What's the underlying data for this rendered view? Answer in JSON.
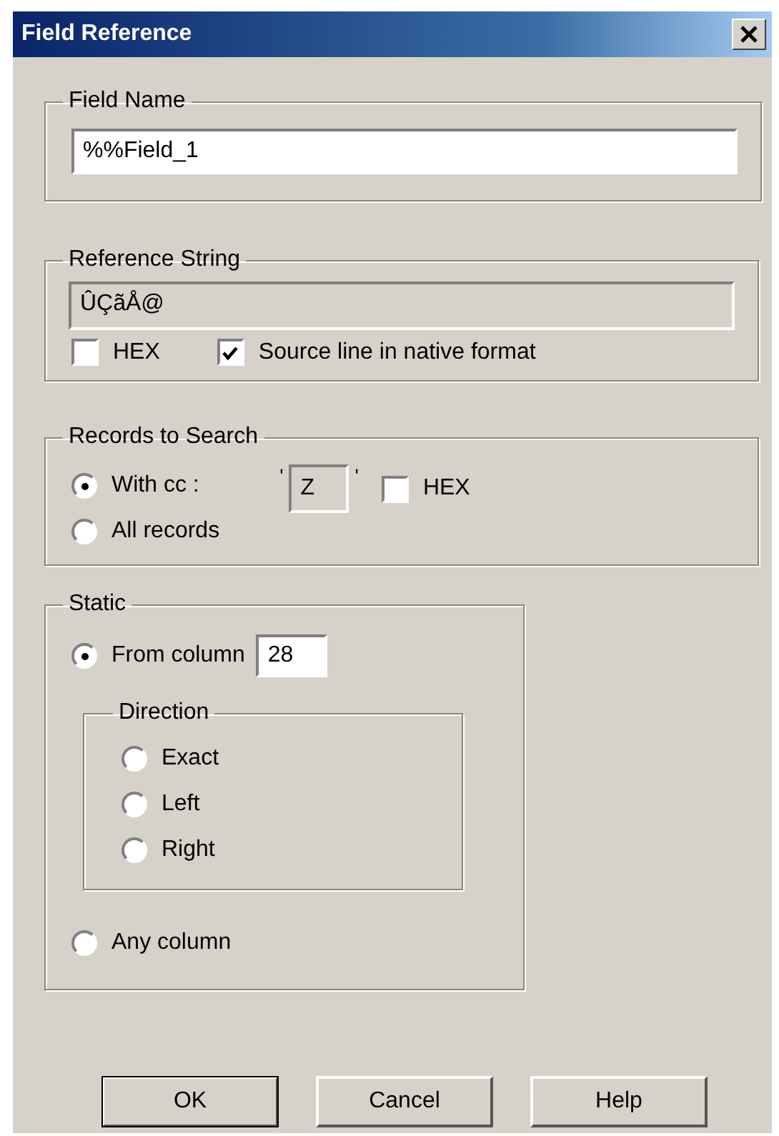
{
  "window": {
    "title": "Field Reference"
  },
  "field_name": {
    "legend": "Field Name",
    "value": "%%Field_1"
  },
  "reference_string": {
    "legend": "Reference String",
    "value": "ÛÇãÅ@",
    "disabled": true,
    "checkboxes": [
      {
        "label": "HEX",
        "checked": false
      },
      {
        "label": "Source line in native format",
        "checked": true
      }
    ]
  },
  "records_to_search": {
    "legend": "Records to Search",
    "options": [
      {
        "label": "With cc :",
        "selected": true
      },
      {
        "label": "All records",
        "selected": false
      }
    ],
    "quote_open": "'",
    "cc_value": "Z",
    "cc_disabled": true,
    "quote_close": "'",
    "hex": {
      "label": "HEX",
      "checked": false
    }
  },
  "static": {
    "legend": "Static",
    "from_column": {
      "label": "From column",
      "selected": true,
      "value": "28"
    },
    "direction": {
      "legend": "Direction",
      "options": [
        {
          "label": "Exact",
          "selected": false
        },
        {
          "label": "Left",
          "selected": false
        },
        {
          "label": "Right",
          "selected": false
        }
      ]
    },
    "any_column": {
      "label": "Any column",
      "selected": false
    }
  },
  "buttons": [
    {
      "label": "OK",
      "default": true
    },
    {
      "label": "Cancel",
      "default": false
    },
    {
      "label": "Help",
      "default": false
    }
  ]
}
